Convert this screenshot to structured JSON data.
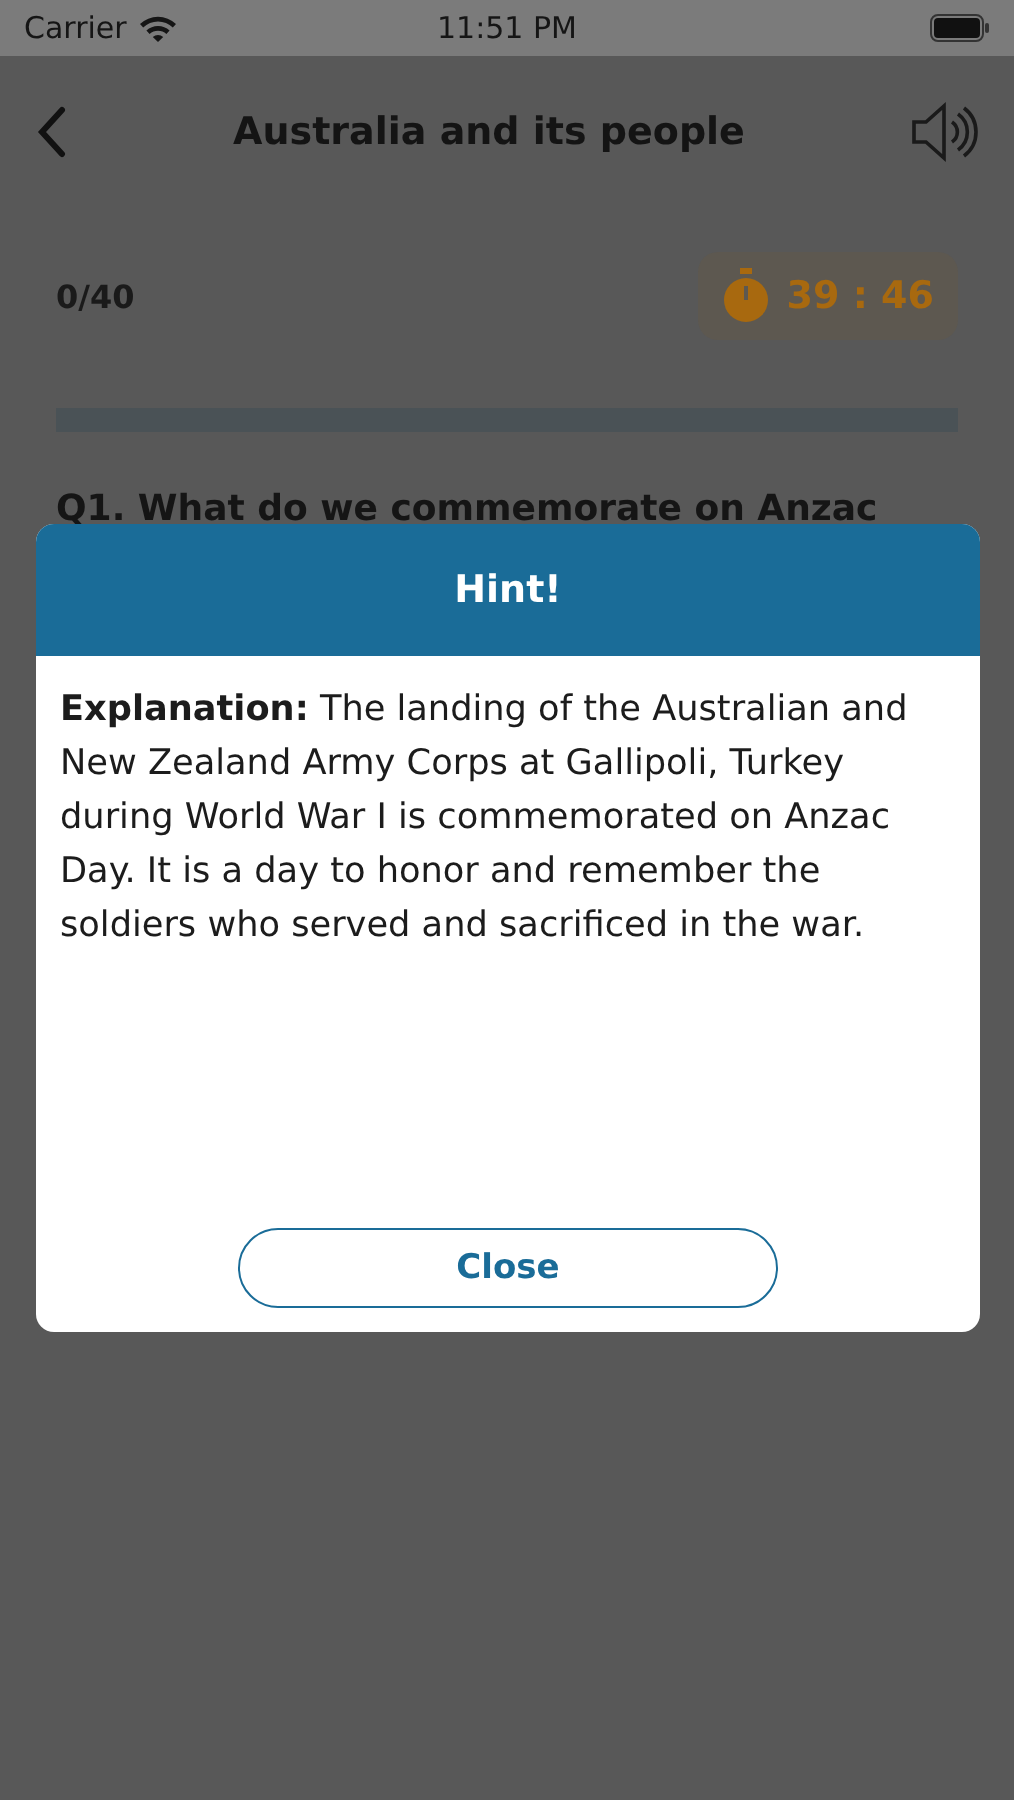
{
  "status_bar": {
    "carrier": "Carrier",
    "time": "11:51 PM"
  },
  "header": {
    "title": "Australia and its people"
  },
  "progress": {
    "count": "0/40",
    "timer": "39 : 46",
    "level": 0
  },
  "question": {
    "text": "Q1. What do we commemorate on Anzac"
  },
  "hint_dialog": {
    "title": "Hint!",
    "body": "**Explanation:** The landing of the Australian and New Zealand Army Corps at Gallipoli, Turkey during World War I is commemorated on Anzac Day. It is a day to honor and remember the soldiers who served and sacrificed in the war.",
    "button": "Close"
  }
}
